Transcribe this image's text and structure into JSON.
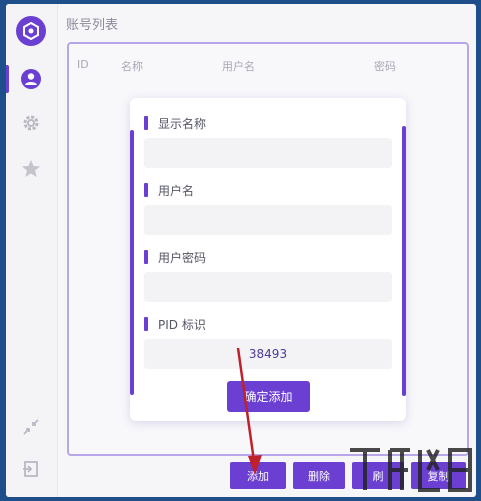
{
  "window": {
    "title": "账号列表"
  },
  "sidebar": {
    "items": [
      {
        "icon": "user-icon",
        "active": true
      },
      {
        "icon": "gear-icon",
        "active": false
      },
      {
        "icon": "star-icon",
        "active": false
      }
    ],
    "bottom": [
      {
        "icon": "shrink-icon"
      },
      {
        "icon": "exit-icon"
      }
    ]
  },
  "table": {
    "columns": [
      "ID",
      "名称",
      "用户名",
      "密码"
    ]
  },
  "dialog": {
    "fields": [
      {
        "label": "显示名称",
        "value": ""
      },
      {
        "label": "用户名",
        "value": ""
      },
      {
        "label": "用户密码",
        "value": ""
      },
      {
        "label": "PID 标识",
        "value": "38493"
      }
    ],
    "confirm_label": "确定添加"
  },
  "footer": {
    "add_label": "添加",
    "delete_label": "删除",
    "btn3_label": "刷",
    "btn4_label": "复制"
  },
  "colors": {
    "accent": "#6a3fd1",
    "background": "#f6f6f9",
    "arrow": "#c0202a"
  }
}
